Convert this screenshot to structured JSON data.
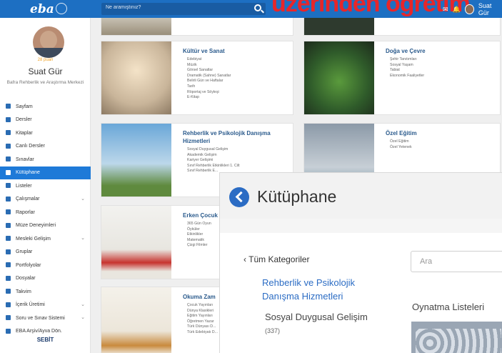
{
  "topbar": {
    "logo": "eba",
    "search_placeholder": "Ne aramıştınız?",
    "overlay_text": "üzerinden öğretim",
    "user_name": "Suat Gür"
  },
  "sidebar": {
    "points": "28 puan",
    "name": "Suat Gür",
    "org": "Bafra Rehberlik ve Araştırma Merkezi",
    "items": [
      {
        "label": "Sayfam",
        "active": false,
        "chevron": false
      },
      {
        "label": "Dersler",
        "active": false,
        "chevron": false
      },
      {
        "label": "Kitaplar",
        "active": false,
        "chevron": false
      },
      {
        "label": "Canlı Dersler",
        "active": false,
        "chevron": false
      },
      {
        "label": "Sınavlar",
        "active": false,
        "chevron": false
      },
      {
        "label": "Kütüphane",
        "active": true,
        "chevron": false
      },
      {
        "label": "Listeler",
        "active": false,
        "chevron": false
      },
      {
        "label": "Çalışmalar",
        "active": false,
        "chevron": true
      },
      {
        "label": "Raporlar",
        "active": false,
        "chevron": false
      },
      {
        "label": "Müze Deneyimleri",
        "active": false,
        "chevron": false
      },
      {
        "label": "Mesleki Gelişim",
        "active": false,
        "chevron": true
      },
      {
        "label": "Gruplar",
        "active": false,
        "chevron": false
      },
      {
        "label": "Portfolyolar",
        "active": false,
        "chevron": false
      },
      {
        "label": "Dosyalar",
        "active": false,
        "chevron": false
      },
      {
        "label": "Takvim",
        "active": false,
        "chevron": false
      },
      {
        "label": "İçerik Üretimi",
        "active": false,
        "chevron": true
      },
      {
        "label": "Soru ve Sınav Sistemi",
        "active": false,
        "chevron": true
      },
      {
        "label": "EBA Arşiv/Ayva Dön.",
        "active": false,
        "chevron": false
      }
    ],
    "footer_logo": "SEBİT"
  },
  "cards": [
    {
      "title": "Kültür ve Sanat",
      "items": [
        "Edebiyat",
        "Müzik",
        "Görsel Sanatlar",
        "Dramatik (Sahne) Sanatlar",
        "Belirli Gün ve Haftalar",
        "Tarih",
        "Röportaj ve Söyleşi",
        "E-Kitap"
      ]
    },
    {
      "title": "Doğa ve Çevre",
      "items": [
        "Şehir Tanıtımları",
        "Sosyal Yaşam",
        "Tabiat",
        "Ekonomik Faaliyetler"
      ]
    },
    {
      "title": "Rehberlik ve Psikolojik Danışma Hizmetleri",
      "items": [
        "Sosyal Duygusal Gelişim",
        "Akademik Gelişim",
        "Kariyer Gelişimi",
        "Sınıf Rehberlik Etkinlikleri 1. Cilt",
        "Sınıf Rehberlik E..."
      ]
    },
    {
      "title": "Özel Eğitim",
      "items": [
        "Özel Eğitim",
        "Özel Yetenek"
      ]
    },
    {
      "title": "Erken Çocuk",
      "items": [
        "365 Gün Oyun",
        "Öyküler",
        "Etkinlikler",
        "Matematik",
        "Çizgi Filmler"
      ]
    },
    {
      "title": "Okuma Zam",
      "items": [
        "Çocuk Yayınları",
        "Dünya Klasikleri",
        "Eğitim Yayınları",
        "Öğretmen Yazar",
        "Türk Dünyası D...",
        "Türk Edebiyatı D..."
      ]
    }
  ],
  "library": {
    "title": "Kütüphane",
    "back_all": "‹  Tüm Kategoriler",
    "category": "Rehberlik ve Psikolojik Danışma Hizmetleri",
    "subcategory": "Sosyal Duygusal Gelişim",
    "subcount": "(337)",
    "search_placeholder": "Ara",
    "playlists": "Oynatma Listeleri"
  }
}
